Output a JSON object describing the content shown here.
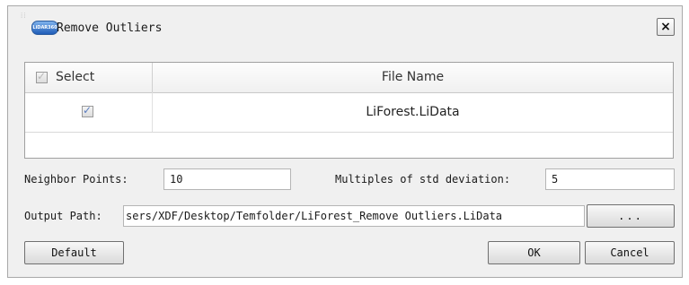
{
  "window": {
    "title": "Remove Outliers",
    "close_glyph": "×",
    "app_icon_text": "LiDAR360"
  },
  "table": {
    "header_select": "Select",
    "header_file_name": "File Name",
    "rows": [
      {
        "checked": true,
        "file_name": "LiForest.LiData"
      }
    ]
  },
  "form": {
    "neighbor_points_label": "Neighbor Points:",
    "neighbor_points_value": "10",
    "multiples_label": "Multiples of std deviation:",
    "multiples_value": "5",
    "output_path_label": "Output Path:",
    "output_path_value": "sers/XDF/Desktop/Temfolder/LiForest_Remove Outliers.LiData",
    "browse_label": "..."
  },
  "buttons": {
    "default": "Default",
    "ok": "OK",
    "cancel": "Cancel"
  },
  "colors": {
    "dialog_bg": "#f0f0f0",
    "checkbox_mark": "#5b7dbf"
  }
}
